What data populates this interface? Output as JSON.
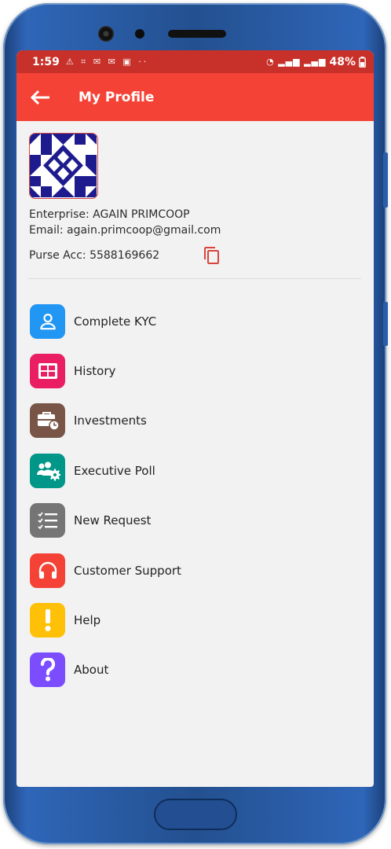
{
  "status_bar": {
    "time": "1:59",
    "battery": "48%"
  },
  "app_bar": {
    "title": "My Profile"
  },
  "profile": {
    "enterprise": "Enterprise: AGAIN PRIMCOOP",
    "email": "Email: again.primcoop@gmail.com",
    "purse_acc": "Purse Acc: 5588169662"
  },
  "menu": [
    {
      "label": "Complete KYC",
      "icon": "person-icon",
      "color": "#2196f3"
    },
    {
      "label": "History",
      "icon": "table-icon",
      "color": "#e91e63"
    },
    {
      "label": "Investments",
      "icon": "briefcase-clock-icon",
      "color": "#795548"
    },
    {
      "label": "Executive Poll",
      "icon": "group-settings-icon",
      "color": "#009688"
    },
    {
      "label": "New Request",
      "icon": "checklist-icon",
      "color": "#757575"
    },
    {
      "label": "Customer Support",
      "icon": "headset-icon",
      "color": "#f44336"
    },
    {
      "label": "Help",
      "icon": "exclamation-icon",
      "color": "#ffc107"
    },
    {
      "label": "About",
      "icon": "question-icon",
      "color": "#7c4dff"
    }
  ],
  "colors": {
    "status_bar": "#c8312a",
    "app_bar": "#f44336",
    "accent": "#d9463c",
    "avatar_pattern": "#1e1b8f"
  }
}
